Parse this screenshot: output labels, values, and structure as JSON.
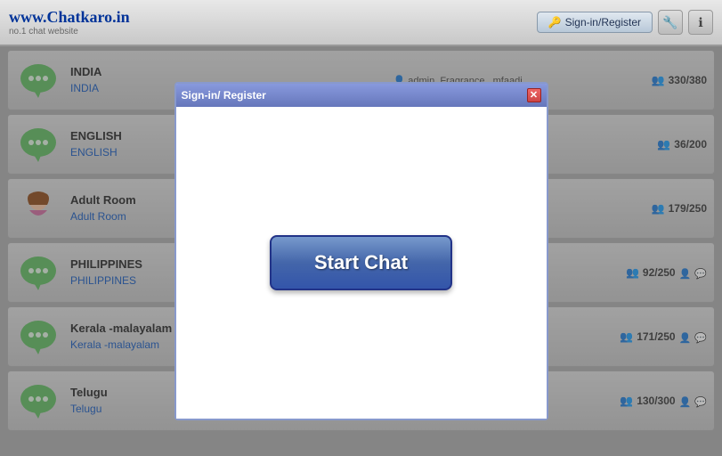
{
  "header": {
    "logo_title": "www.Chatkaro.in",
    "logo_subtitle": "no.1 chat website",
    "signin_label": "Sign-in/Register",
    "signin_icon": "🔑",
    "settings_icon": "🔧",
    "info_icon": "ℹ"
  },
  "rooms": [
    {
      "id": "india",
      "name": "INDIA",
      "link_label": "INDIA",
      "center_text": "admin, Fragrance., mfaadi",
      "stats": "330/380",
      "has_sub_icons": false,
      "icon_type": "bubble"
    },
    {
      "id": "english",
      "name": "ENGLISH",
      "link_label": "ENGLISH",
      "center_text": "",
      "stats": "36/200",
      "has_sub_icons": false,
      "icon_type": "bubble"
    },
    {
      "id": "adult",
      "name": "Adult Room",
      "link_label": "Adult Room",
      "center_text": "",
      "stats": "179/250",
      "has_sub_icons": false,
      "icon_type": "girl"
    },
    {
      "id": "philippines",
      "name": "PHILIPPINES",
      "link_label": "PHILIPPINES",
      "center_text": "",
      "stats": "92/250",
      "has_sub_icons": true,
      "icon_type": "bubble"
    },
    {
      "id": "kerala",
      "name": "Kerala -malayalam",
      "link_label": "Kerala -malayalam",
      "center_text": "",
      "stats": "171/250",
      "has_sub_icons": true,
      "icon_type": "bubble"
    },
    {
      "id": "telugu",
      "name": "Telugu",
      "link_label": "Telugu",
      "center_text": "",
      "stats": "130/300",
      "has_sub_icons": true,
      "icon_type": "bubble"
    }
  ],
  "modal": {
    "title": "Sign-in/ Register",
    "close_icon": "✕",
    "start_chat_label": "Start Chat"
  }
}
